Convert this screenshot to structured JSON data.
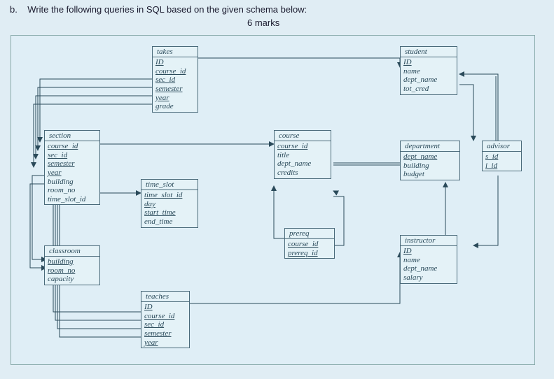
{
  "question": {
    "label": "b.",
    "text": "Write the following queries in SQL based on the given schema below:",
    "marks": "6 marks"
  },
  "entities": {
    "takes": {
      "title": "takes",
      "attrs": [
        "ID",
        "course_id",
        "sec_id",
        "semester",
        "year",
        "grade"
      ],
      "pk": [
        "ID",
        "course_id",
        "sec_id",
        "semester",
        "year"
      ]
    },
    "student": {
      "title": "student",
      "attrs": [
        "ID",
        "name",
        "dept_name",
        "tot_cred"
      ],
      "pk": [
        "ID"
      ]
    },
    "section": {
      "title": "section",
      "attrs": [
        "course_id",
        "sec_id",
        "semester",
        "year",
        "building",
        "room_no",
        "time_slot_id"
      ],
      "pk": [
        "course_id",
        "sec_id",
        "semester",
        "year"
      ]
    },
    "course": {
      "title": "course",
      "attrs": [
        "course_id",
        "title",
        "dept_name",
        "credits"
      ],
      "pk": [
        "course_id"
      ]
    },
    "department": {
      "title": "department",
      "attrs": [
        "dept_name",
        "building",
        "budget"
      ],
      "pk": [
        "dept_name"
      ]
    },
    "advisor": {
      "title": "advisor",
      "attrs": [
        "s_id",
        "i_id"
      ],
      "pk": [
        "s_id"
      ]
    },
    "time_slot": {
      "title": "time_slot",
      "attrs": [
        "time_slot_id",
        "day",
        "start_time",
        "end_time"
      ],
      "pk": [
        "time_slot_id",
        "day",
        "start_time"
      ]
    },
    "classroom": {
      "title": "classroom",
      "attrs": [
        "building",
        "room_no",
        "capacity"
      ],
      "pk": [
        "building",
        "room_no"
      ]
    },
    "prereq": {
      "title": "prereq",
      "attrs": [
        "course_id",
        "prereq_id"
      ],
      "pk": [
        "course_id",
        "prereq_id"
      ]
    },
    "instructor": {
      "title": "instructor",
      "attrs": [
        "ID",
        "name",
        "dept_name",
        "salary"
      ],
      "pk": [
        "ID"
      ]
    },
    "teaches": {
      "title": "teaches",
      "attrs": [
        "ID",
        "course_id",
        "sec_id",
        "semester",
        "year"
      ],
      "pk": [
        "ID",
        "course_id",
        "sec_id",
        "semester",
        "year"
      ]
    }
  }
}
